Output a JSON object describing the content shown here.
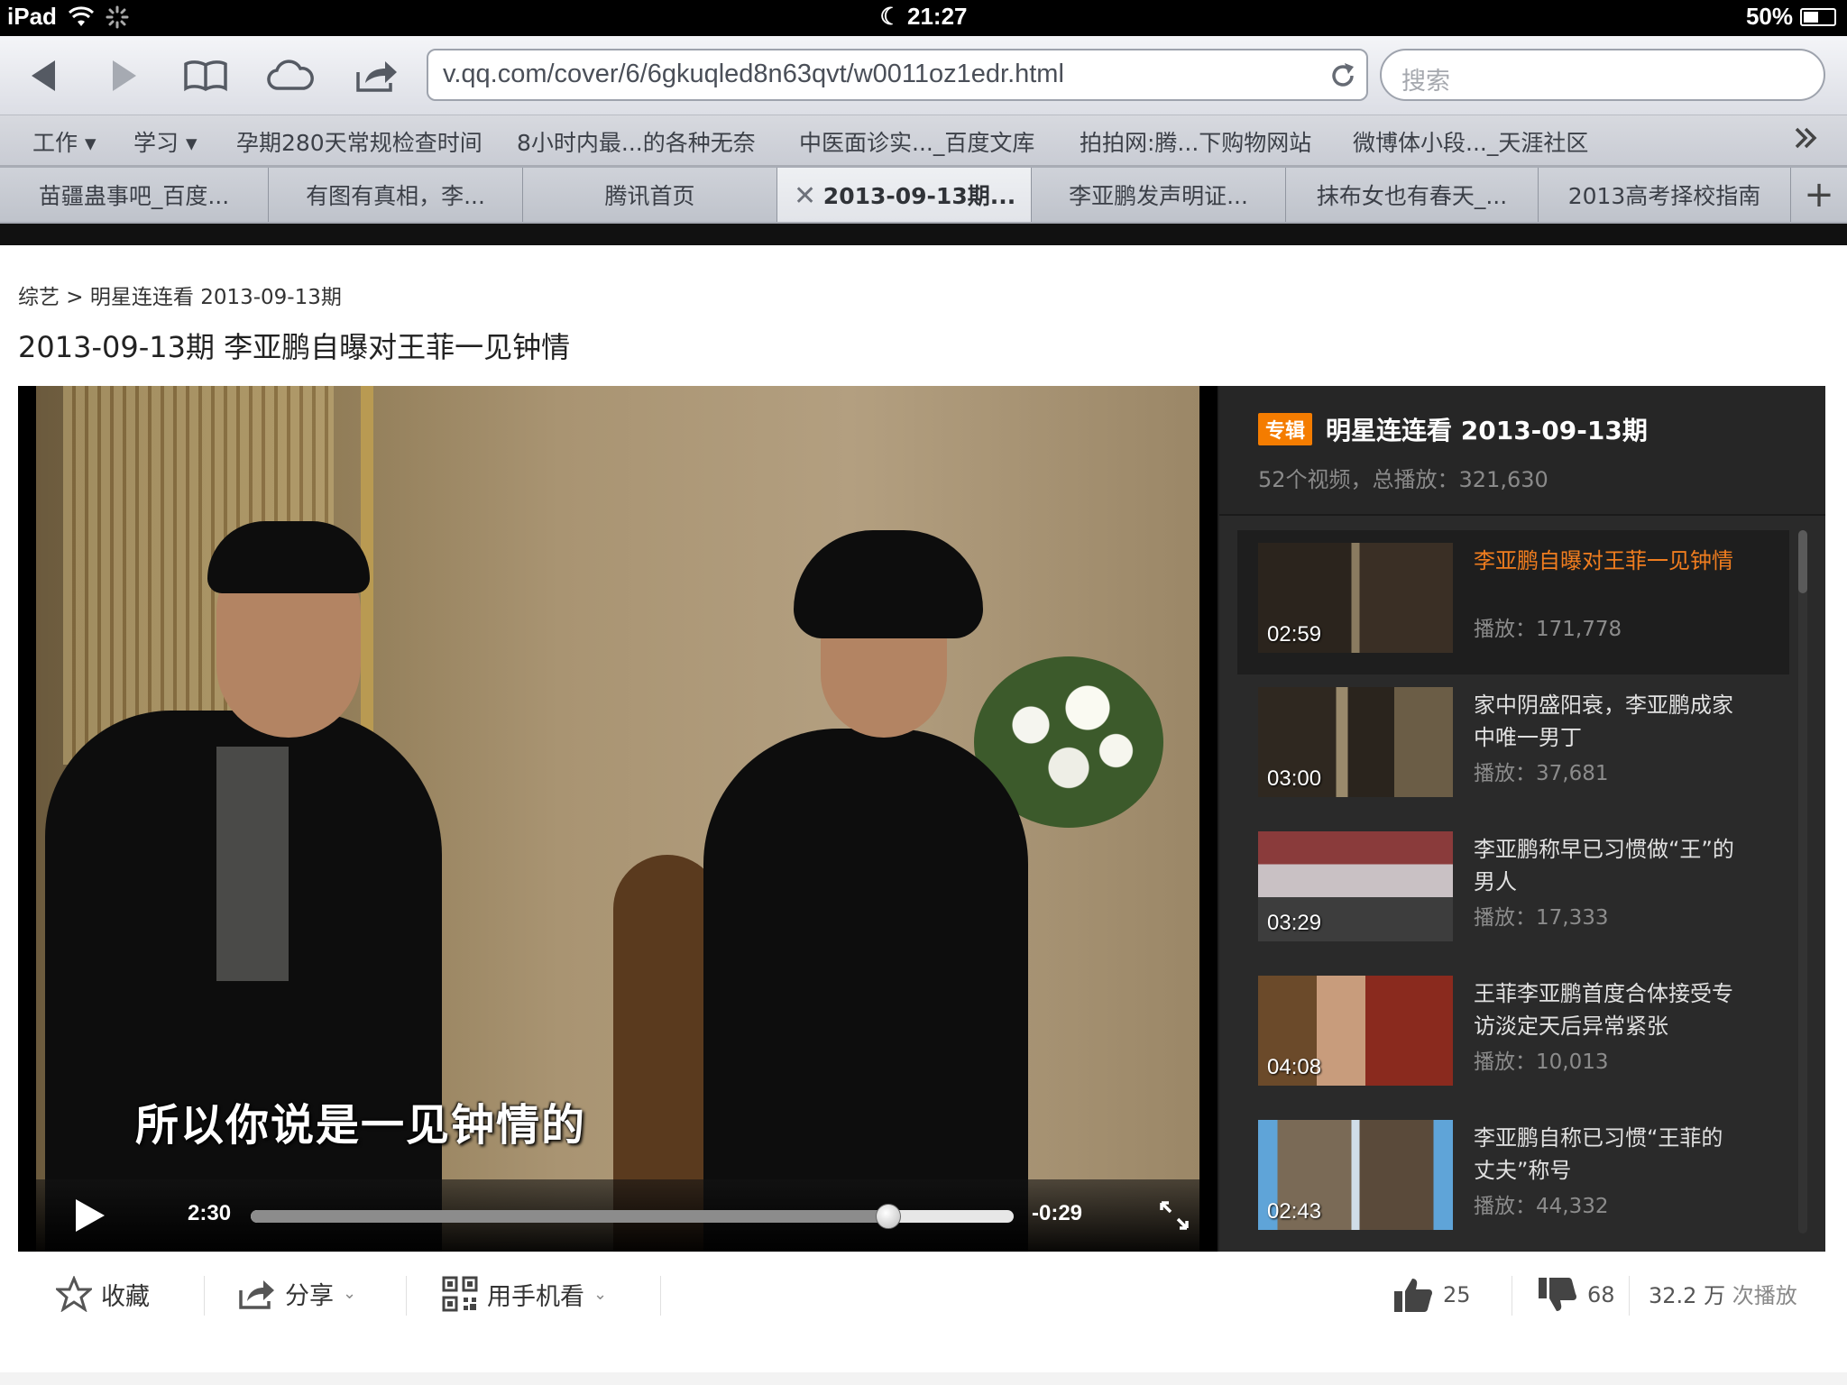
{
  "status": {
    "device": "iPad",
    "time": "21:27",
    "battery": "50%",
    "battery_level": 0.5
  },
  "toolbar": {
    "url": "v.qq.com/cover/6/6gkuqled8n63qvt/w0011oz1edr.html",
    "search_placeholder": "搜索"
  },
  "bookmarks": [
    "工作 ▾",
    "学习 ▾",
    "孕期280天常规检查时间",
    "8小时内最...的各种无奈",
    "中医面诊实..._百度文库",
    "拍拍网:腾...下购物网站",
    "微博体小段..._天涯社区"
  ],
  "tabs": [
    "苗疆蛊事吧_百度...",
    "有图有真相，李...",
    "腾讯首页",
    "2013-09-13期...",
    "李亚鹏发声明证...",
    "抹布女也有春天_...",
    "2013高考择校指南"
  ],
  "active_tab": 3,
  "page": {
    "breadcrumb": "综艺 > 明星连连看 2013-09-13期",
    "title": "2013-09-13期 李亚鹏自曝对王菲一见钟情"
  },
  "player": {
    "subtitle": "所以你说是一见钟情的",
    "elapsed": "2:30",
    "remaining": "-0:29",
    "progress": 0.836
  },
  "playlist": {
    "tag": "专辑",
    "title": "明星连连看 2013-09-13期",
    "meta": "52个视频，总播放：321,630",
    "items": [
      {
        "title": "李亚鹏自曝对王菲一见钟情",
        "plays": "播放：171,778",
        "duration": "02:59",
        "active": true
      },
      {
        "title": "家中阴盛阳衰，李亚鹏成家中唯一男丁",
        "plays": "播放：37,681",
        "duration": "03:00"
      },
      {
        "title": "李亚鹏称早已习惯做“王”的男人",
        "plays": "播放：17,333",
        "duration": "03:29"
      },
      {
        "title": "王菲李亚鹏首度合体接受专访淡定天后异常紧张",
        "plays": "播放：10,013",
        "duration": "04:08"
      },
      {
        "title": "李亚鹏自称已习惯“王菲的丈夫”称号",
        "plays": "播放：44,332",
        "duration": "02:43"
      }
    ]
  },
  "actions": {
    "favorite": "收藏",
    "share": "分享",
    "mobile": "用手机看",
    "likes": "25",
    "dislikes": "68",
    "views": "32.2 万",
    "views_unit": "次播放"
  },
  "colors": {
    "accent": "#f47c00",
    "active_title": "#f07d1f",
    "panel_bg": "#2a2a2a"
  }
}
